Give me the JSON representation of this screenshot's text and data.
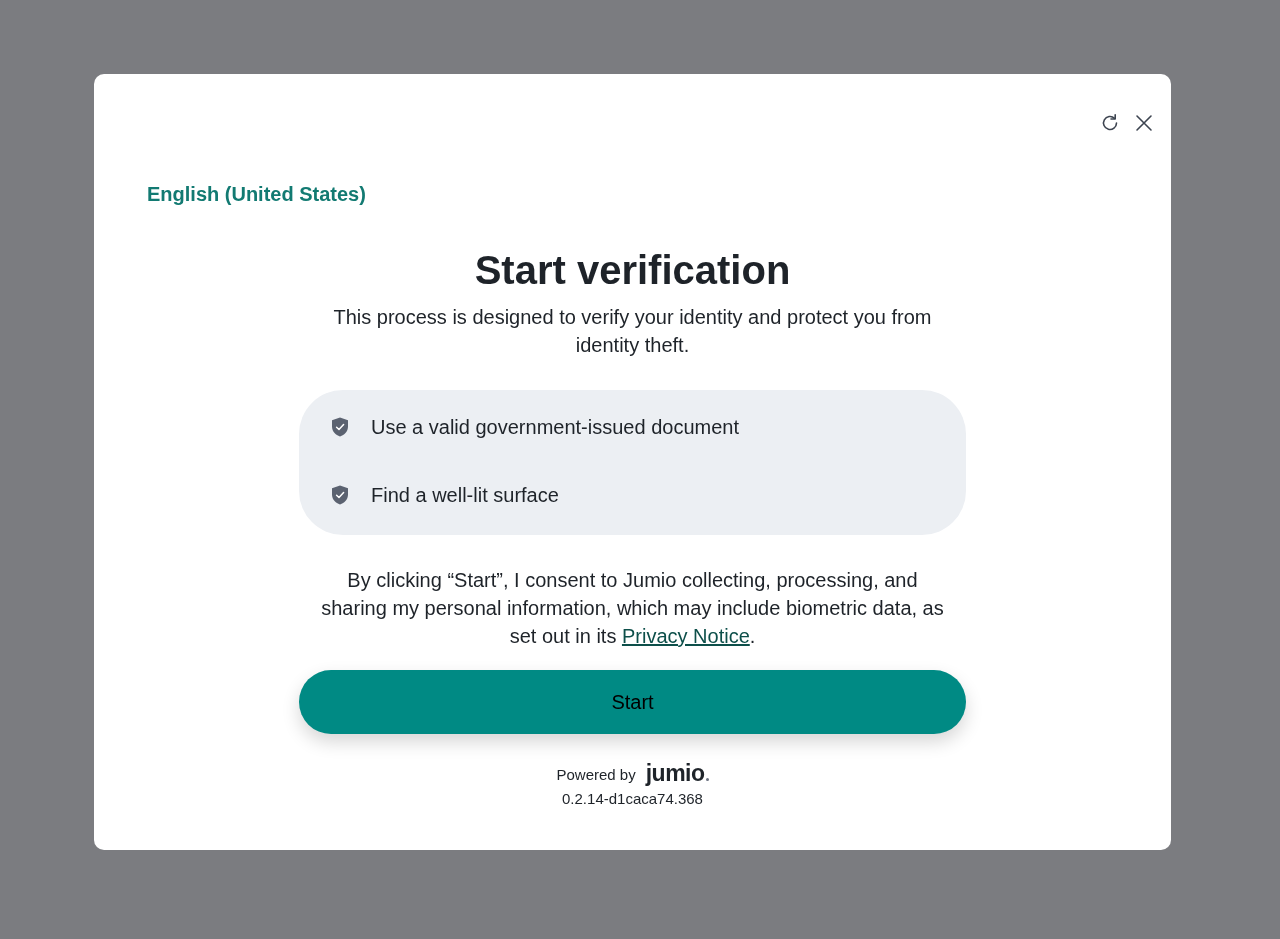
{
  "language": {
    "label": "English (United States)"
  },
  "title": "Start verification",
  "subtitle": "This process is designed to verify your identity and protect you from identity theft.",
  "requirements": [
    {
      "text": "Use a valid government-issued document"
    },
    {
      "text": "Find a well-lit surface"
    }
  ],
  "consent": {
    "text": "By clicking “Start”, I consent to Jumio collecting, processing, and sharing my personal information, which may include biometric data, as set out in its ",
    "link": "Privacy Notice",
    "end": "."
  },
  "start_button": {
    "label": "Start"
  },
  "footer": {
    "powered_by": "Powered by",
    "logo": "jumio",
    "version": "0.2.14-d1caca74.368"
  }
}
